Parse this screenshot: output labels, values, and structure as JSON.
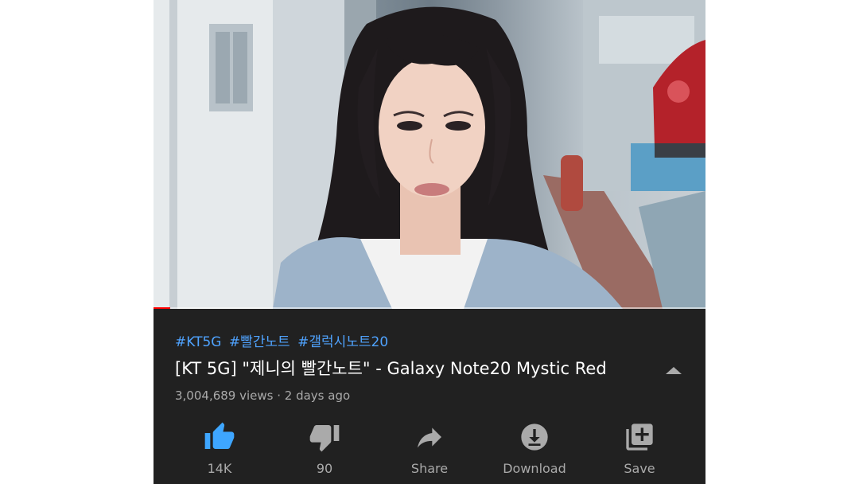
{
  "video": {
    "progress_fraction": 0.03
  },
  "info": {
    "hashtags": [
      "#KT5G",
      "#빨간노트",
      "#갤럭시노트20"
    ],
    "title": "[KT 5G] \"제니의 빨간노트\" - Galaxy Note20 Mystic Red",
    "meta": "3,004,689 views · 2 days ago"
  },
  "actions": {
    "like": {
      "label": "14K",
      "icon": "thumbs-up-icon",
      "color": "#3ea6ff"
    },
    "dislike": {
      "label": "90",
      "icon": "thumbs-down-icon"
    },
    "share": {
      "label": "Share",
      "icon": "share-arrow-icon"
    },
    "download": {
      "label": "Download",
      "icon": "download-icon"
    },
    "save": {
      "label": "Save",
      "icon": "playlist-add-icon"
    }
  },
  "colors": {
    "background": "#212121",
    "hashtag": "#4fa3ff",
    "progress": "#ff0000",
    "muted_text": "#aaaaaa"
  }
}
